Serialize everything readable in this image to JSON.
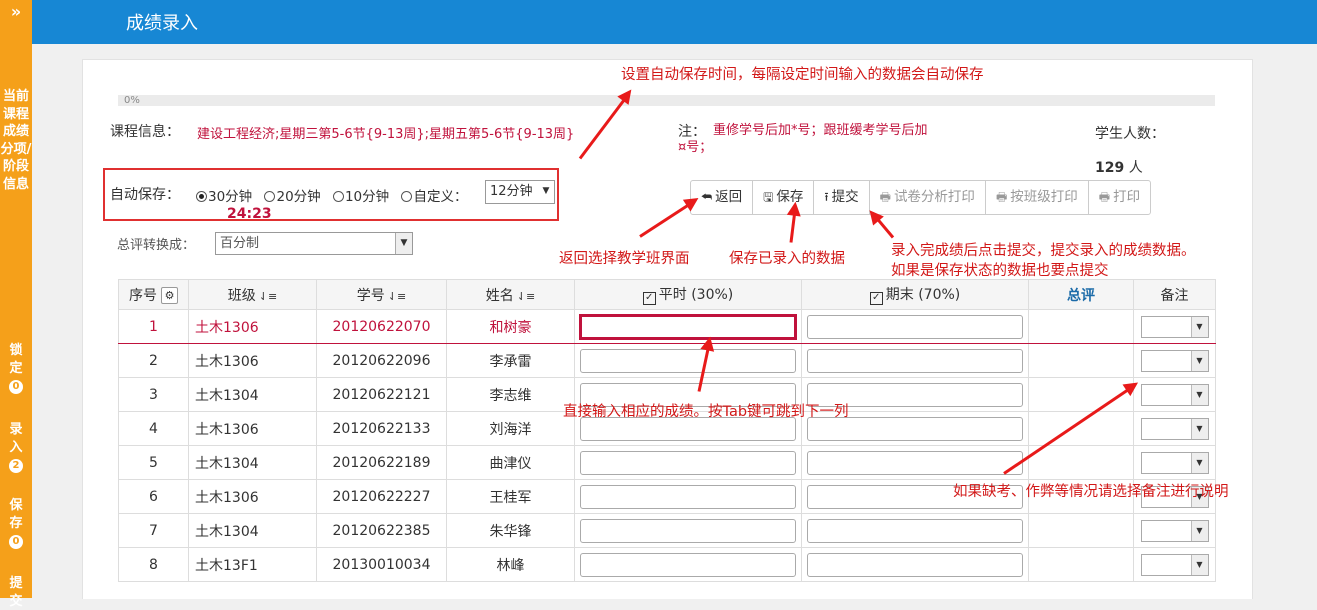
{
  "sidebar": {
    "toggle": "»",
    "current_label": "当前课程成绩分项/阶段信息",
    "sections": [
      {
        "label": "锁定",
        "count": "0"
      },
      {
        "label": "录入",
        "count": "2"
      },
      {
        "label": "保存",
        "count": "0"
      },
      {
        "label": "提交",
        "count": ""
      }
    ]
  },
  "header": {
    "title": "成绩录入"
  },
  "progress": {
    "label": "0%",
    "value": 0
  },
  "course": {
    "label": "课程信息：",
    "value": "建设工程经济;星期三第5-6节{9-13周};星期五第5-6节{9-13周}"
  },
  "note": {
    "label": "注：",
    "text": "重修学号后加*号；跟班缓考学号后加¤号；"
  },
  "students": {
    "label": "学生人数：",
    "count": "129",
    "unit": "人"
  },
  "autosave": {
    "label": "自动保存：",
    "options": [
      "30分钟",
      "20分钟",
      "10分钟",
      "自定义："
    ],
    "selected": "30分钟",
    "custom_value": "12分钟",
    "timer": "24:23"
  },
  "conversion": {
    "label": "总评转换成：",
    "value": "百分制"
  },
  "toolbar": {
    "back": "返回",
    "save": "保存",
    "submit": "提交",
    "print_analysis": "试卷分析打印",
    "print_class": "按班级打印",
    "print": "打印"
  },
  "table": {
    "headers": {
      "index": "序号",
      "class": "班级",
      "student_id": "学号",
      "name": "姓名",
      "regular": "平时 (30%)",
      "final": "期末 (70%)",
      "overall": "总评",
      "remark": "备注"
    },
    "rows": [
      {
        "index": "1",
        "class": "土木1306",
        "student_id": "20120622070",
        "name": "和树豪"
      },
      {
        "index": "2",
        "class": "土木1306",
        "student_id": "20120622096",
        "name": "李承雷"
      },
      {
        "index": "3",
        "class": "土木1304",
        "student_id": "20120622121",
        "name": "李志维"
      },
      {
        "index": "4",
        "class": "土木1306",
        "student_id": "20120622133",
        "name": "刘海洋"
      },
      {
        "index": "5",
        "class": "土木1304",
        "student_id": "20120622189",
        "name": "曲津仪"
      },
      {
        "index": "6",
        "class": "土木1306",
        "student_id": "20120622227",
        "name": "王桂军"
      },
      {
        "index": "7",
        "class": "土木1304",
        "student_id": "20120622385",
        "name": "朱华锋"
      },
      {
        "index": "8",
        "class": "土木13F1",
        "student_id": "20130010034",
        "name": "林峰"
      }
    ]
  },
  "annotations": {
    "autosave": "设置自动保存时间，每隔设定时间输入的数据会自动保存",
    "back": "返回选择教学班界面",
    "save": "保存已录入的数据",
    "submit_line1": "录入完成绩后点击提交，提交录入的成绩数据。",
    "submit_line2": "如果是保存状态的数据也要点提交",
    "input": "直接输入相应的成绩。按Tab键可跳到下一列",
    "remark": "如果缺考、作弊等情况请选择备注进行说明"
  },
  "colors": {
    "sidebar": "#f5a01a",
    "header": "#1787d4",
    "accent": "#c0123c",
    "annotation": "#d21818"
  }
}
